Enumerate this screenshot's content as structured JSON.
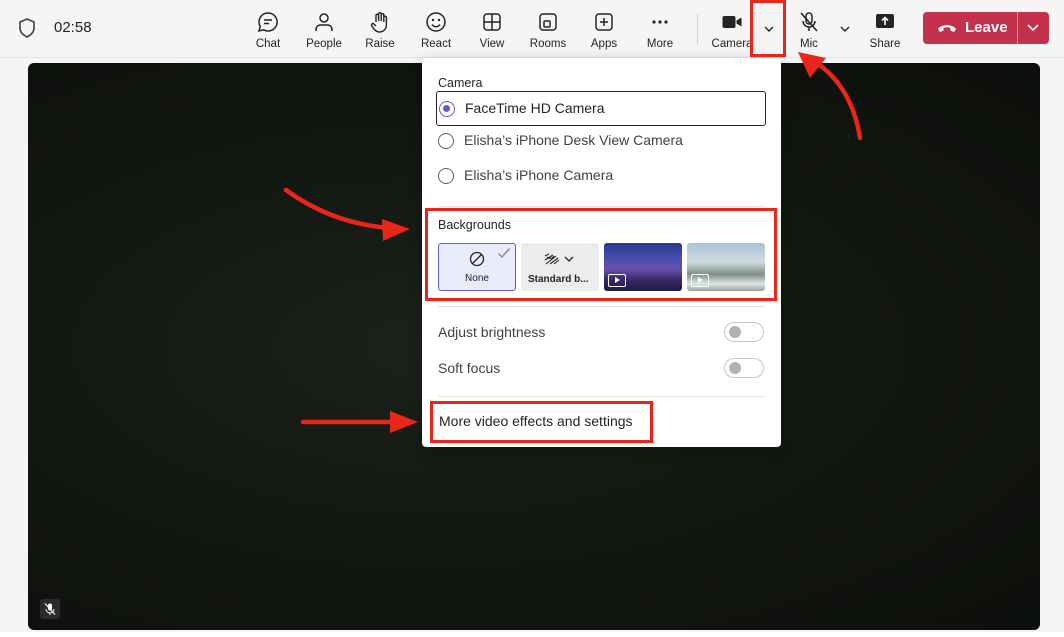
{
  "meeting": {
    "timer": "02:58"
  },
  "toolbar": {
    "chat": "Chat",
    "people": "People",
    "raise": "Raise",
    "react": "React",
    "view": "View",
    "rooms": "Rooms",
    "apps": "Apps",
    "more": "More",
    "camera": "Camera",
    "mic": "Mic",
    "share": "Share",
    "leave": "Leave"
  },
  "camera_menu": {
    "camera_heading": "Camera",
    "cameras": [
      {
        "name": "FaceTime HD Camera",
        "selected": true
      },
      {
        "name": "Elisha’s iPhone Desk View Camera",
        "selected": false
      },
      {
        "name": "Elisha’s iPhone Camera",
        "selected": false
      }
    ],
    "backgrounds_heading": "Backgrounds",
    "backgrounds": [
      {
        "label": "None",
        "selected": true
      },
      {
        "label": "Standard b..."
      }
    ],
    "adjust_brightness": {
      "label": "Adjust brightness",
      "on": false
    },
    "soft_focus": {
      "label": "Soft focus",
      "on": false
    },
    "more_settings": "More video effects and settings"
  },
  "colors": {
    "leave_red": "#c4314b",
    "accent": "#5b5fc7",
    "annotation_red": "#e8261a"
  }
}
